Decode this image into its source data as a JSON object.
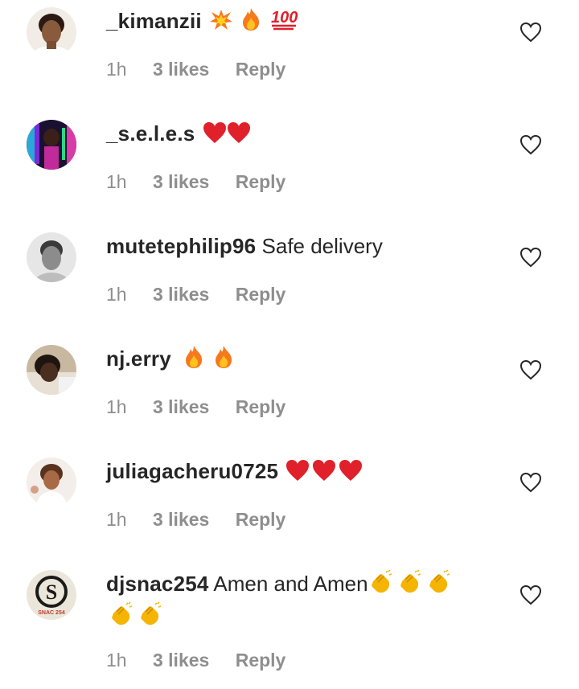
{
  "comments": [
    {
      "username": "_kimanzii",
      "text": "",
      "emojis": [
        "collision",
        "fire",
        "hundred"
      ],
      "time": "1h",
      "likes": "3 likes",
      "reply": "Reply"
    },
    {
      "username": "_s.e.l.e.s",
      "text": "",
      "emojis": [
        "red-heart",
        "red-heart"
      ],
      "time": "1h",
      "likes": "3 likes",
      "reply": "Reply"
    },
    {
      "username": "mutetephilip96",
      "text": "Safe delivery",
      "emojis": [],
      "time": "1h",
      "likes": "3 likes",
      "reply": "Reply"
    },
    {
      "username": "nj.erry",
      "text": "",
      "emojis": [
        "fire",
        "fire"
      ],
      "time": "1h",
      "likes": "3 likes",
      "reply": "Reply"
    },
    {
      "username": "juliagacheru0725",
      "text": "",
      "emojis": [
        "red-heart",
        "red-heart",
        "red-heart"
      ],
      "time": "1h",
      "likes": "3 likes",
      "reply": "Reply"
    },
    {
      "username": "djsnac254",
      "text": "Amen and Amen",
      "emojis": [
        "clapping-hands",
        "clapping-hands",
        "clapping-hands",
        "clapping-hands",
        "clapping-hands"
      ],
      "time": "1h",
      "likes": "3 likes",
      "reply": "Reply"
    }
  ],
  "avatar_logo_text": "SNAC 254",
  "colors": {
    "text": "#262626",
    "meta": "#8e8e8e",
    "heart_red": "#e0202a",
    "fire_orange": "#f7791e",
    "clap_yellow": "#f5b400"
  }
}
